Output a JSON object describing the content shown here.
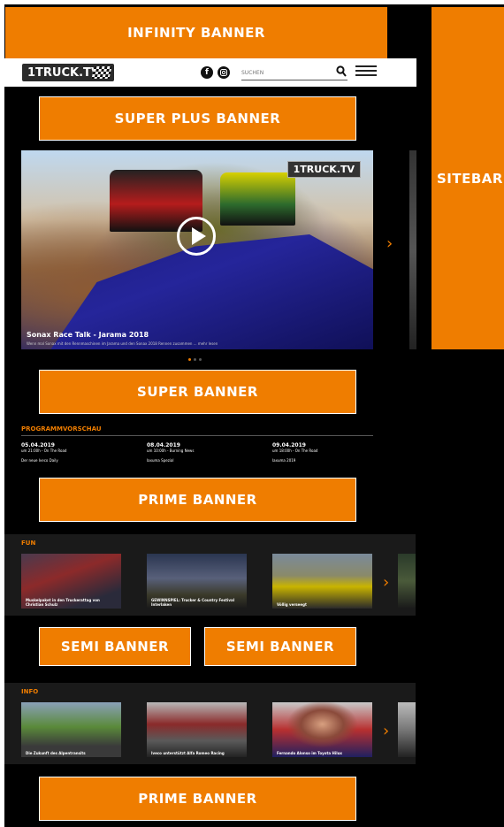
{
  "banners": {
    "infinity": "INFINITY BANNER",
    "sitebar": "SITEBAR",
    "super_plus": "SUPER PLUS BANNER",
    "super": "SUPER BANNER",
    "prime_1": "PRIME BANNER",
    "semi_1": "SEMI BANNER",
    "semi_2": "SEMI BANNER",
    "prime_2": "PRIME BANNER"
  },
  "header": {
    "logo": "1TRUCK.TV",
    "search_placeholder": "SUCHEN",
    "icons": [
      "facebook-icon",
      "instagram-icon",
      "search-icon",
      "menu-icon"
    ]
  },
  "video": {
    "logo": "1TRUCK.TV",
    "title": "Sonax Race Talk - Jarama 2018",
    "subtitle": "Wenn mal Sonax mit den Rennmaschinen im Jarama und den Sonax 2018 Rennen zusammen ... mehr lesen"
  },
  "program": {
    "title": "PROGRAMMVORSCHAU",
    "items": [
      {
        "date": "05.04.2019",
        "time": "um 21:00h - On The Road",
        "show": "Der neue Iveco Daily"
      },
      {
        "date": "08.04.2019",
        "time": "um 10:00h - Burning News",
        "show": "Iaxuma Spezial"
      },
      {
        "date": "09.04.2019",
        "time": "um 18:00h - On The Road",
        "show": "Iaxuma 2019"
      }
    ]
  },
  "fun": {
    "title": "FUN",
    "items": [
      {
        "caption": "Muskelpaket in den Truckerattag von Christian Schulz"
      },
      {
        "caption": "GEWINNSPIEL: Trucker & Country Festival Interlaken"
      },
      {
        "caption": "Völlig verseegt"
      }
    ]
  },
  "info": {
    "title": "INFO",
    "items": [
      {
        "caption": "Die Zukunft des Alpentransits"
      },
      {
        "caption": "Iveco unterstützt Alfa Romeo Racing"
      },
      {
        "caption": "Fernando Alonso im Toyota Hilux"
      }
    ]
  },
  "colors": {
    "accent": "#ef7d00",
    "background": "#000000"
  }
}
